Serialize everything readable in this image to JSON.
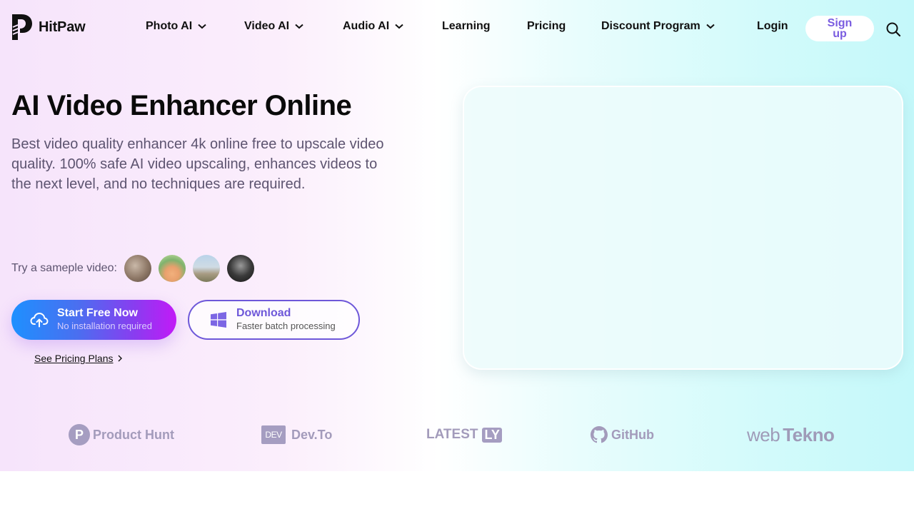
{
  "brand": {
    "name": "HitPaw"
  },
  "nav": {
    "items": [
      {
        "label": "Photo AI",
        "has_dropdown": true
      },
      {
        "label": "Video AI",
        "has_dropdown": true
      },
      {
        "label": "Audio AI",
        "has_dropdown": true
      },
      {
        "label": "Learning",
        "has_dropdown": false
      },
      {
        "label": "Pricing",
        "has_dropdown": false
      },
      {
        "label": "Discount Program",
        "has_dropdown": true
      }
    ],
    "login_label": "Login",
    "signup_label": "Sign up",
    "search_icon": "search-icon"
  },
  "hero": {
    "title": "AI Video Enhancer Online",
    "description": "Best video quality enhancer 4k online free to upscale video quality. 100% safe AI video upscaling, enhances videos to the next level, and no techniques are required.",
    "sample_label": "Try a sameple video:",
    "samples": [
      "sample-video-1",
      "sample-video-2",
      "sample-video-3",
      "sample-video-4"
    ],
    "start_button": {
      "main": "Start Free Now",
      "sub": "No installation required",
      "icon": "cloud-upload-icon"
    },
    "download_button": {
      "main": "Download",
      "sub": "Faster batch processing",
      "icon": "windows-icon"
    },
    "pricing_link": "See Pricing Plans"
  },
  "partners": [
    {
      "name": "Product Hunt",
      "badge": "P"
    },
    {
      "name": "Dev.To",
      "badge": "DEV"
    },
    {
      "name": "LATEST",
      "badge": "LY"
    },
    {
      "name": "GitHub"
    },
    {
      "name_light": "web",
      "name_bold": "Tekno"
    }
  ],
  "colors": {
    "accent": "#6e58d9",
    "signup_text": "#7a5de0",
    "gradient_start": "#1e90ff",
    "gradient_end": "#c21af7",
    "partner_gray": "#a39bbb"
  }
}
